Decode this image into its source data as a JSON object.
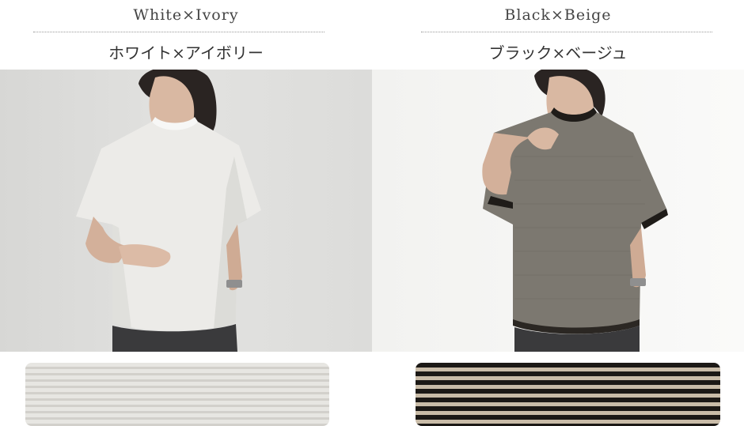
{
  "variants": [
    {
      "name_en": "White×Ivory",
      "name_jp": "ホワイト×アイボリー",
      "swatch_colors": [
        "#e7e6e2",
        "#d2d0cb"
      ]
    },
    {
      "name_en": "Black×Beige",
      "name_jp": "ブラック×ベージュ",
      "swatch_colors": [
        "#1c1916",
        "#c9bca8"
      ]
    }
  ]
}
